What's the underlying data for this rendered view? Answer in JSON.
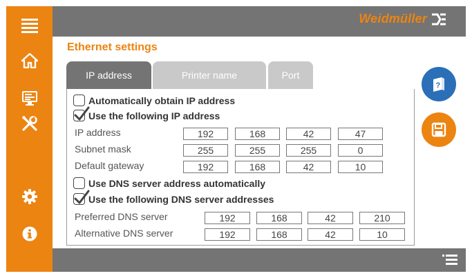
{
  "brand": {
    "name": "Weidmüller"
  },
  "page": {
    "title": "Ethernet settings"
  },
  "tabs": [
    {
      "label": "IP address",
      "active": true
    },
    {
      "label": "Printer name",
      "active": false
    },
    {
      "label": "Port",
      "active": false
    }
  ],
  "ip_mode": {
    "auto_label": "Automatically obtain IP address",
    "auto_checked": false,
    "manual_label": "Use the following IP address",
    "manual_checked": true
  },
  "ip_fields": [
    {
      "label": "IP address",
      "octets": [
        "192",
        "168",
        "42",
        "47"
      ]
    },
    {
      "label": "Subnet mask",
      "octets": [
        "255",
        "255",
        "255",
        "0"
      ]
    },
    {
      "label": "Default gateway",
      "octets": [
        "192",
        "168",
        "42",
        "10"
      ]
    }
  ],
  "dns_mode": {
    "auto_label": "Use DNS server address automatically",
    "auto_checked": false,
    "manual_label": "Use the following DNS server addresses",
    "manual_checked": true
  },
  "dns_fields": [
    {
      "label": "Preferred DNS server",
      "octets": [
        "192",
        "168",
        "42",
        "210"
      ]
    },
    {
      "label": "Alternative DNS server",
      "octets": [
        "192",
        "168",
        "42",
        "10"
      ]
    }
  ],
  "colors": {
    "accent": "#ec8412",
    "bar": "#747474",
    "help_button": "#2a6fb8",
    "save_button": "#ec8412"
  },
  "icons": {
    "sidebar": [
      "menu-icon",
      "home-icon",
      "monitor-icon",
      "tools-icon",
      "gear-icon",
      "info-icon"
    ],
    "actions": [
      "help-book-icon",
      "save-icon"
    ],
    "bottom": [
      "list-menu-icon"
    ]
  }
}
